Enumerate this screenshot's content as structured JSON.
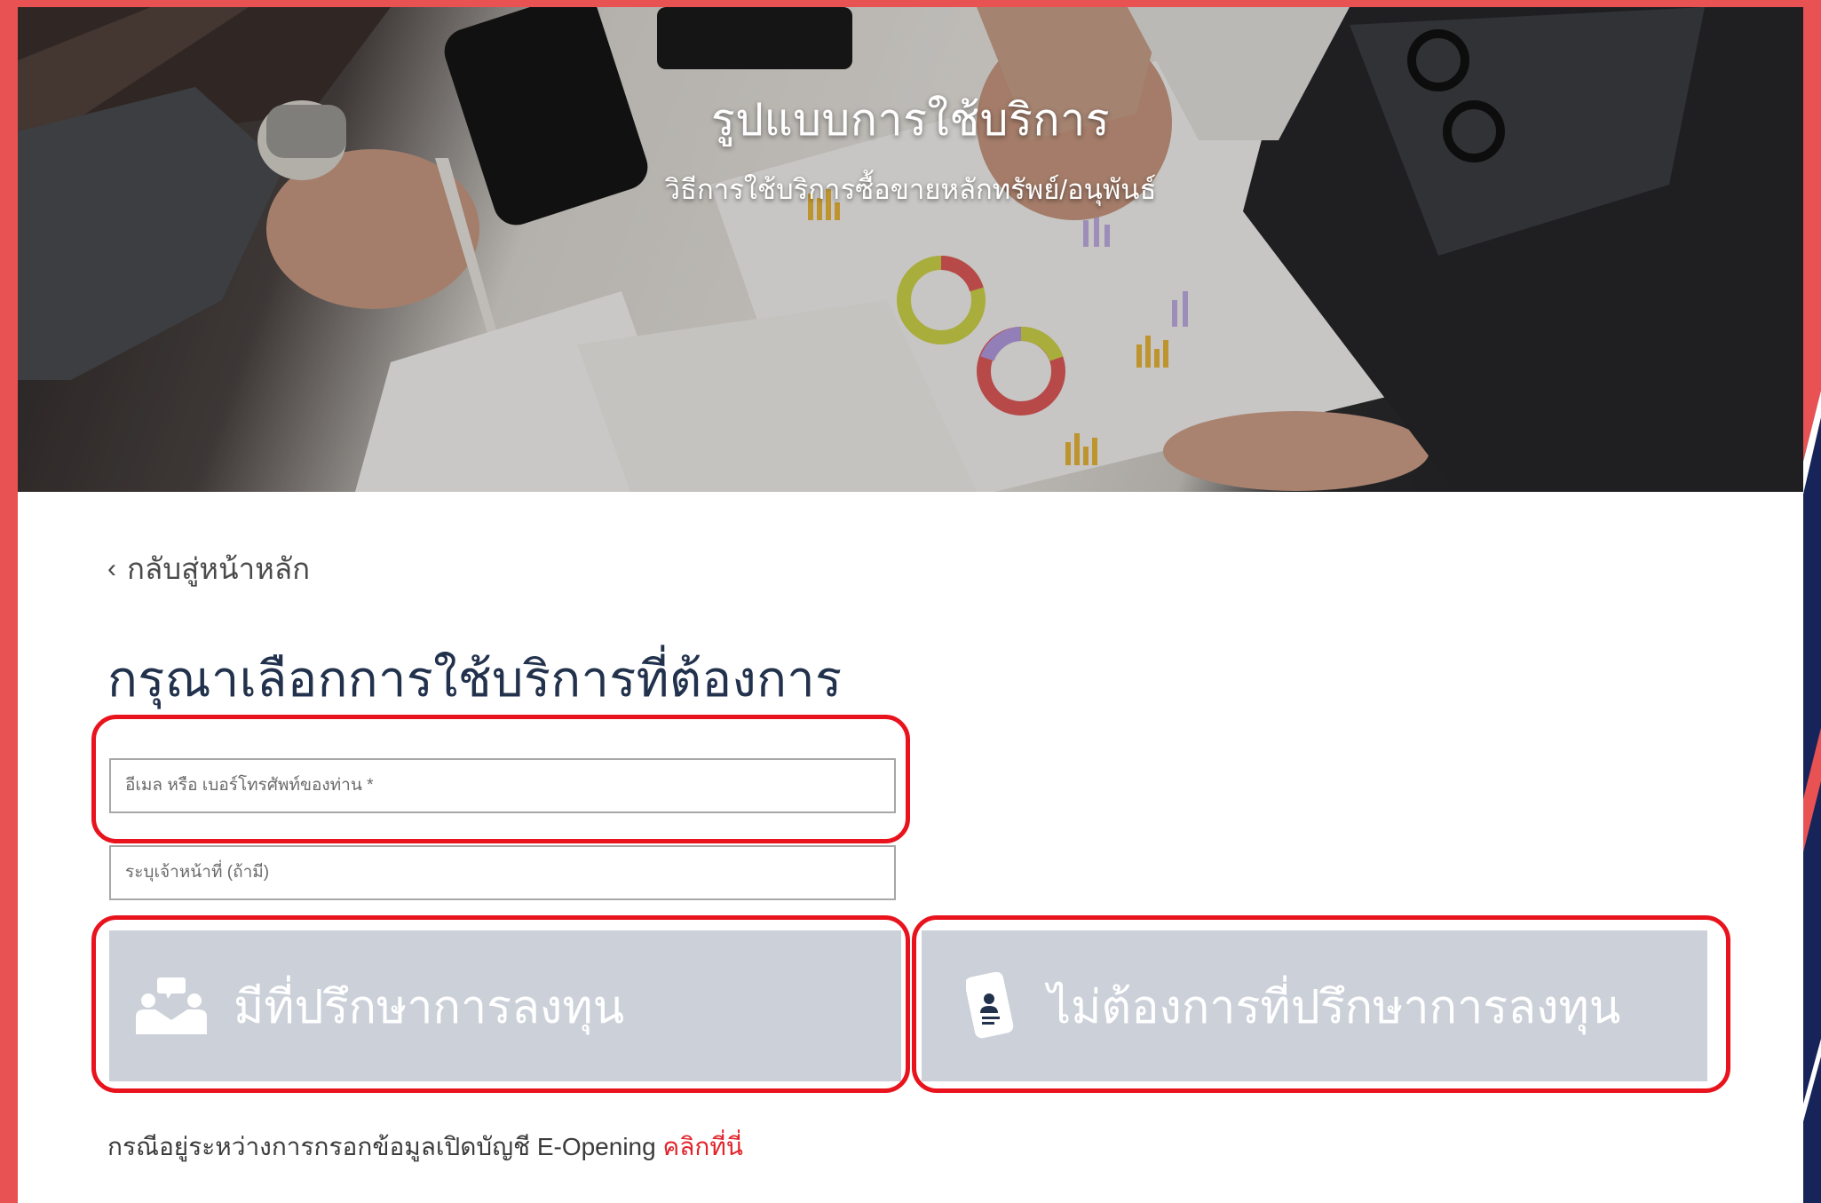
{
  "hero": {
    "title": "รูปแบบการใช้บริการ",
    "subtitle": "วิธีการใช้บริการซื้อขายหลักทรัพย์/อนุพันธ์"
  },
  "nav": {
    "back_label": "กลับสู่หน้าหลัก",
    "back_icon": "chevron-left-icon"
  },
  "main": {
    "heading": "กรุณาเลือกการใช้บริการที่ต้องการ",
    "email_field": {
      "placeholder": "อีเมล หรือ เบอร์โทรศัพท์ของท่าน *",
      "value": ""
    },
    "staff_field": {
      "placeholder": "ระบุเจ้าหน้าที่ (ถ้ามี)",
      "value": ""
    },
    "options": [
      {
        "label": "มีที่ปรึกษาการลงทุน",
        "icon": "advisor-meeting-icon"
      },
      {
        "label": "ไม่ต้องการที่ปรึกษาการลงทุน",
        "icon": "mobile-profile-icon"
      }
    ],
    "note": {
      "text": "กรณีอยู่ระหว่างการกรอกข้อมูลเปิดบัญชี E-Opening",
      "link": "คลิกที่นี่"
    }
  },
  "colors": {
    "frame": "#e85252",
    "heading": "#22324d",
    "button_bg": "#cbd0d9",
    "highlight": "#e8131c",
    "link": "#e1232a"
  }
}
